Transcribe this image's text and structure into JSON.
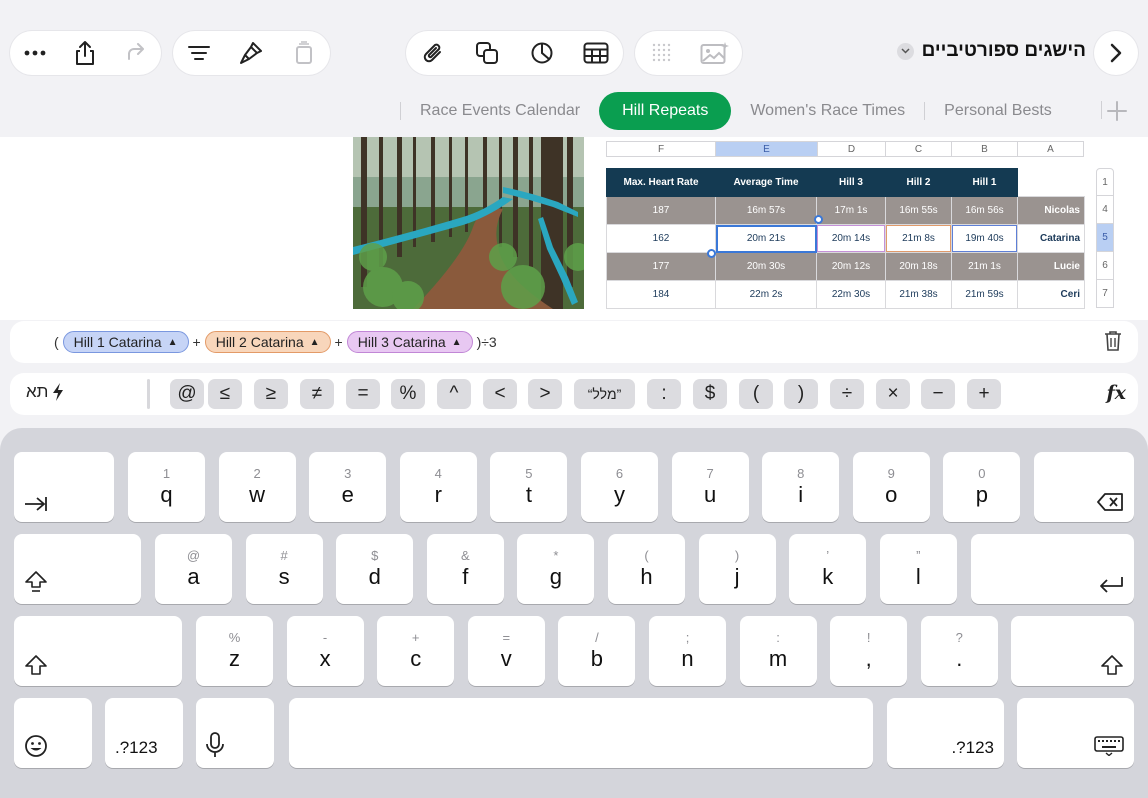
{
  "doc": {
    "title": "הישגים ספורטיביים"
  },
  "tabs": [
    {
      "label": "Race Events Calendar",
      "active": false
    },
    {
      "label": "Hill Repeats",
      "active": true
    },
    {
      "label": "Women's Race Times",
      "active": false
    },
    {
      "label": "Personal Bests",
      "active": false
    }
  ],
  "columns": [
    "F",
    "E",
    "D",
    "C",
    "B",
    "A"
  ],
  "rows": [
    "1",
    "4",
    "5",
    "6",
    "7"
  ],
  "table": {
    "headers": [
      "Max. Heart Rate",
      "Average Time",
      "Hill 3",
      "Hill 2",
      "Hill 1"
    ],
    "body": [
      {
        "hr": "187",
        "avg": "16m 57s",
        "h3": "17m 1s",
        "h2": "16m 55s",
        "h1": "16m 56s",
        "name": "Nicolas"
      },
      {
        "hr": "162",
        "avg": "20m 21s",
        "h3": "20m 14s",
        "h2": "21m 8s",
        "h1": "19m 40s",
        "name": "Catarina"
      },
      {
        "hr": "177",
        "avg": "20m 30s",
        "h3": "20m 12s",
        "h2": "20m 18s",
        "h1": "21m 1s",
        "name": "Lucie"
      },
      {
        "hr": "184",
        "avg": "22m 2s",
        "h3": "22m 30s",
        "h2": "21m 38s",
        "h1": "21m 59s",
        "name": "Ceri"
      }
    ]
  },
  "formula": {
    "open": "(",
    "token1": "Hill 1 Catarina",
    "token2": "Hill 2 Catarina",
    "token3": "Hill 3 Catarina",
    "plus": "+",
    "close": ")÷3",
    "tri": "▲"
  },
  "formula_keys": {
    "lang": "תא",
    "keys": [
      "@",
      "≤",
      "≥",
      "≠",
      "=",
      "%",
      "^",
      "<",
      ">",
      "“מלל”",
      ":",
      "$",
      "(",
      ")",
      "÷",
      "×",
      "−",
      "+"
    ],
    "fx": "fx"
  },
  "keyboard": {
    "row1": [
      {
        "main": "q",
        "sub": "1"
      },
      {
        "main": "w",
        "sub": "2"
      },
      {
        "main": "e",
        "sub": "3"
      },
      {
        "main": "r",
        "sub": "4"
      },
      {
        "main": "t",
        "sub": "5"
      },
      {
        "main": "y",
        "sub": "6"
      },
      {
        "main": "u",
        "sub": "7"
      },
      {
        "main": "i",
        "sub": "8"
      },
      {
        "main": "o",
        "sub": "9"
      },
      {
        "main": "p",
        "sub": "0"
      }
    ],
    "row2": [
      {
        "main": "a",
        "sub": "@"
      },
      {
        "main": "s",
        "sub": "#"
      },
      {
        "main": "d",
        "sub": "$"
      },
      {
        "main": "f",
        "sub": "&"
      },
      {
        "main": "g",
        "sub": "*"
      },
      {
        "main": "h",
        "sub": "("
      },
      {
        "main": "j",
        "sub": ")"
      },
      {
        "main": "k",
        "sub": "’"
      },
      {
        "main": "l",
        "sub": "”"
      }
    ],
    "row3": [
      {
        "main": "z",
        "sub": "%"
      },
      {
        "main": "x",
        "sub": "-"
      },
      {
        "main": "c",
        "sub": "+"
      },
      {
        "main": "v",
        "sub": "="
      },
      {
        "main": "b",
        "sub": "/"
      },
      {
        "main": "n",
        "sub": ";"
      },
      {
        "main": "m",
        "sub": ":"
      },
      {
        "main": ",",
        "sub": "!"
      },
      {
        "main": ".",
        "sub": "?"
      }
    ],
    "num_label": ".?123"
  }
}
